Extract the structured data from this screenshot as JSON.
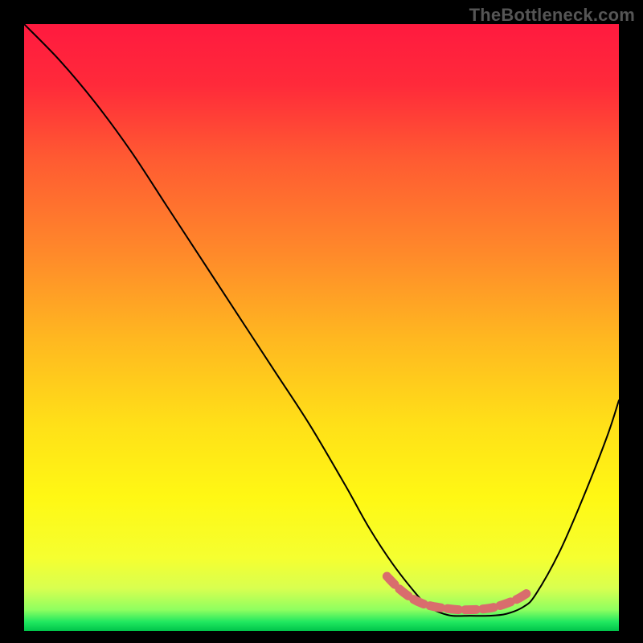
{
  "watermark": "TheBottleneck.com",
  "chart_data": {
    "type": "line",
    "title": "",
    "xlabel": "",
    "ylabel": "",
    "xlim": [
      0,
      100
    ],
    "ylim": [
      0,
      100
    ],
    "grid": false,
    "series": [
      {
        "name": "bottleneck-curve",
        "color": "#000000",
        "x": [
          0,
          6,
          12,
          18,
          24,
          30,
          36,
          42,
          48,
          54,
          58,
          62,
          66,
          68,
          70,
          72,
          75,
          78,
          81,
          84,
          86,
          90,
          94,
          98,
          100
        ],
        "y": [
          100,
          94,
          87,
          79,
          70,
          61,
          52,
          43,
          34,
          24,
          17,
          11,
          6,
          4,
          3,
          2.5,
          2.5,
          2.5,
          2.8,
          4,
          6,
          13,
          22,
          32,
          38
        ]
      },
      {
        "name": "highlight-band",
        "color": "#d96d6d",
        "x": [
          61,
          63,
          65,
          67,
          69,
          71,
          73,
          75,
          77,
          79,
          81,
          83,
          85
        ],
        "y": [
          9,
          7,
          5.5,
          4.5,
          4,
          3.7,
          3.5,
          3.5,
          3.6,
          3.9,
          4.5,
          5.3,
          6.5
        ]
      }
    ],
    "background_gradient": {
      "stops": [
        {
          "offset": 0.0,
          "color": "#ff1a3f"
        },
        {
          "offset": 0.1,
          "color": "#ff2a3a"
        },
        {
          "offset": 0.22,
          "color": "#ff5a32"
        },
        {
          "offset": 0.38,
          "color": "#ff8a2a"
        },
        {
          "offset": 0.52,
          "color": "#ffb820"
        },
        {
          "offset": 0.66,
          "color": "#ffe018"
        },
        {
          "offset": 0.78,
          "color": "#fff814"
        },
        {
          "offset": 0.88,
          "color": "#f5ff30"
        },
        {
          "offset": 0.93,
          "color": "#d8ff50"
        },
        {
          "offset": 0.965,
          "color": "#8fff60"
        },
        {
          "offset": 0.985,
          "color": "#20e860"
        },
        {
          "offset": 1.0,
          "color": "#00c44a"
        }
      ]
    }
  }
}
